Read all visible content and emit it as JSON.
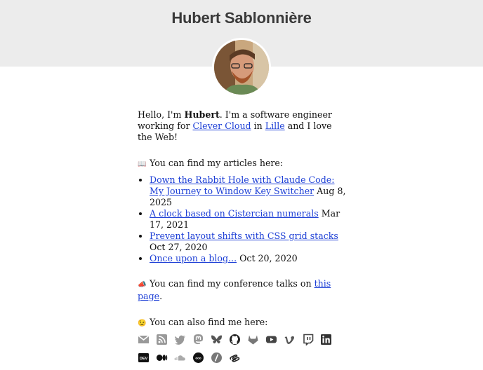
{
  "header": {
    "title": "Hubert Sablonnière",
    "avatar_icon": "portrait-photo"
  },
  "intro": {
    "hello": "Hello, I'm ",
    "name": "Hubert",
    "text1": ". I'm a software engineer working for ",
    "company": "Clever Cloud",
    "text2": " in ",
    "city": "Lille",
    "text3": " and I love the Web!"
  },
  "articles": {
    "emoji": "📖",
    "heading": "You can find my articles here:",
    "items": [
      {
        "title": "Down the Rabbit Hole with Claude Code: My Journey to Window Key Switcher",
        "date": " Aug 8, 2025"
      },
      {
        "title": "A clock based on Cistercian numerals",
        "date": " Mar 17, 2021"
      },
      {
        "title": "Prevent layout shifts with CSS grid stacks",
        "date": " Oct 27, 2020"
      },
      {
        "title": "Once upon a blog...",
        "date": " Oct 20, 2020"
      }
    ]
  },
  "talks": {
    "emoji": "📣",
    "text": "You can find my conference talks on ",
    "link": "this page",
    "suffix": "."
  },
  "social": {
    "emoji": "😉",
    "heading": "You can also find me here:",
    "row1": [
      "gmail-icon",
      "rss-icon",
      "twitter-icon",
      "mastodon-icon",
      "bluesky-icon",
      "github-icon",
      "gitlab-icon",
      "youtube-icon",
      "vimeo-icon",
      "twitch-icon",
      "linkedin-icon"
    ],
    "row2": [
      "dev-icon",
      "medium-icon",
      "soundcloud-icon",
      "mixcloud-icon",
      "slash-icon",
      "speakerdeck-icon"
    ]
  }
}
